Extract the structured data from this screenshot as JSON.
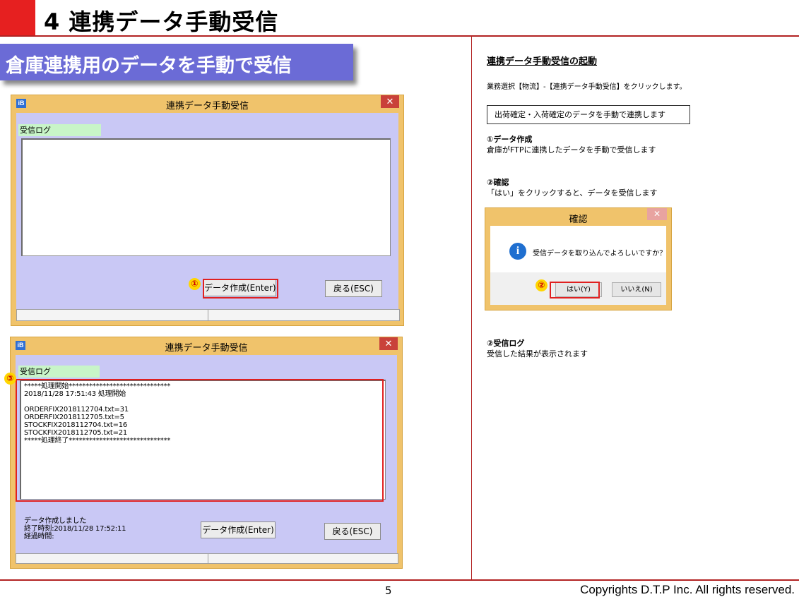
{
  "header": {
    "title": "4  連携データ手動受信"
  },
  "banner": "倉庫連携用のデータを手動で受信",
  "window1": {
    "app_icon": "iB",
    "title": "連携データ手動受信",
    "close": "✕",
    "log_label": "受信ログ",
    "create_button": "データ作成(Enter)",
    "back_button": "戻る(ESC)",
    "marker": "①"
  },
  "window2": {
    "app_icon": "iB",
    "title": "連携データ手動受信",
    "close": "✕",
    "log_label": "受信ログ",
    "marker": "③",
    "log_lines": [
      "*****処理開始******************************",
      "2018/11/28 17:51:43 処理開始",
      "",
      "ORDERFIX2018112704.txt=31",
      "ORDERFIX2018112705.txt=5",
      "STOCKFIX2018112704.txt=16",
      "STOCKFIX2018112705.txt=21",
      "*****処理終了******************************"
    ],
    "status_lines": [
      "データ作成しました",
      "終了時刻:2018/11/28 17:52:11",
      "経過時間:"
    ],
    "create_button": "データ作成(Enter)",
    "back_button": "戻る(ESC)"
  },
  "right": {
    "heading": "連携データ手動受信の起動",
    "intro": "業務選択【物流】-【連携データ手動受信】をクリックします。",
    "box": "出荷確定・入荷確定のデータを手動で連携します",
    "step1_title": "①データ作成",
    "step1_text": "倉庫がFTPに連携したデータを手動で受信します",
    "step2_title": "②確認",
    "step2_text": "「はい」をクリックすると、データを受信します",
    "step3_title": "②受信ログ",
    "step3_text": "受信した結果が表示されます"
  },
  "dialog": {
    "title": "確認",
    "close": "✕",
    "icon": "i",
    "message": "受信データを取り込んでよろしいですか？",
    "yes": "はい(Y)",
    "no": "いいえ(N)",
    "marker": "②"
  },
  "footer": {
    "page": "5",
    "copyright": "Copyrights  D.T.P Inc. All rights reserved."
  }
}
